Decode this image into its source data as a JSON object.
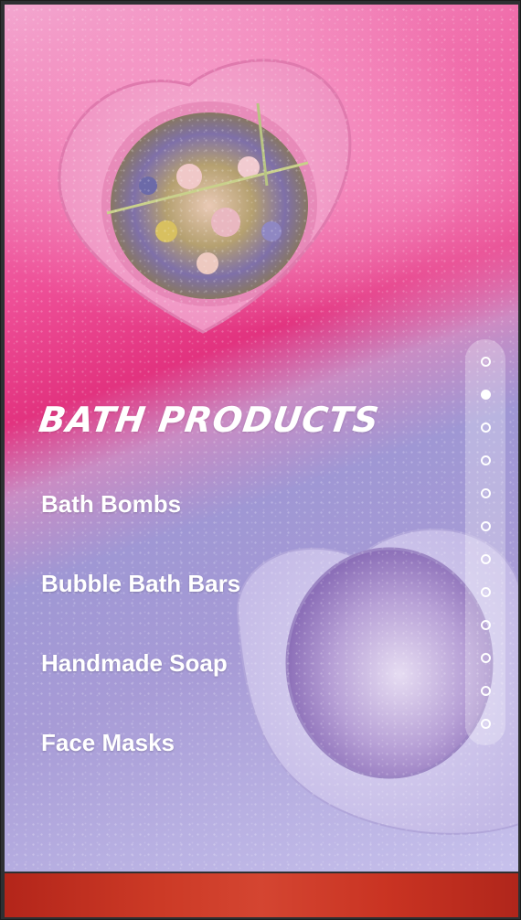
{
  "category": {
    "title": "BATH PRODUCTS"
  },
  "products": [
    {
      "label": "Bath Bombs"
    },
    {
      "label": "Bubble Bath Bars"
    },
    {
      "label": "Handmade Soap"
    },
    {
      "label": "Face Masks"
    }
  ],
  "pager": {
    "total": 12,
    "active_index": 1
  },
  "colors": {
    "pink_accent": "#ee4f97",
    "lavender": "#a79bd6",
    "footer_red": "#c93322"
  }
}
